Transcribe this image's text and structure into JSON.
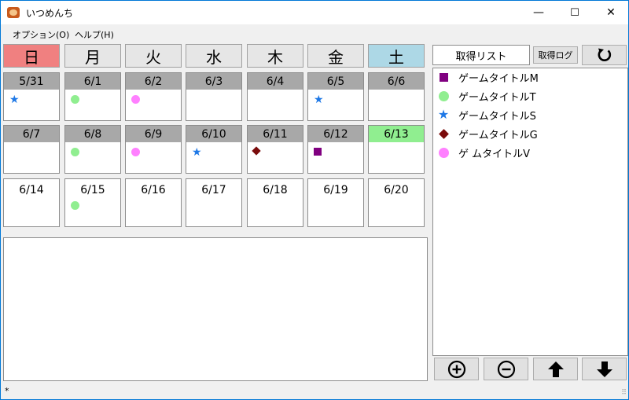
{
  "window": {
    "title": "いつめんち",
    "minimize": "—",
    "maximize": "☐",
    "close": "✕"
  },
  "menu": {
    "options": "オプション(O)",
    "help": "ヘルプ(H)"
  },
  "weekdays": [
    "日",
    "月",
    "火",
    "水",
    "木",
    "金",
    "土"
  ],
  "colors": {
    "sunday": "#f08080",
    "saturday": "#add8e6",
    "today": "#90ee90",
    "M": "#800080",
    "T": "#90ee90",
    "S": "#1e78e6",
    "G": "#7a0b0b",
    "V": "#ff80ff"
  },
  "weeks": [
    [
      {
        "date": "5/31",
        "marks": [
          "S"
        ]
      },
      {
        "date": "6/1",
        "marks": [
          "T"
        ]
      },
      {
        "date": "6/2",
        "marks": [
          "V"
        ]
      },
      {
        "date": "6/3",
        "marks": []
      },
      {
        "date": "6/4",
        "marks": []
      },
      {
        "date": "6/5",
        "marks": [
          "S"
        ]
      },
      {
        "date": "6/6",
        "marks": []
      }
    ],
    [
      {
        "date": "6/7",
        "marks": []
      },
      {
        "date": "6/8",
        "marks": [
          "T"
        ]
      },
      {
        "date": "6/9",
        "marks": [
          "V"
        ]
      },
      {
        "date": "6/10",
        "marks": [
          "S"
        ]
      },
      {
        "date": "6/11",
        "marks": [
          "G"
        ]
      },
      {
        "date": "6/12",
        "marks": [
          "M"
        ]
      },
      {
        "date": "6/13",
        "marks": [],
        "today": true
      }
    ],
    [
      {
        "date": "6/14",
        "marks": []
      },
      {
        "date": "6/15",
        "marks": [
          "T"
        ]
      },
      {
        "date": "6/16",
        "marks": []
      },
      {
        "date": "6/17",
        "marks": []
      },
      {
        "date": "6/18",
        "marks": []
      },
      {
        "date": "6/19",
        "marks": []
      },
      {
        "date": "6/20",
        "marks": []
      }
    ]
  ],
  "memo": {
    "value": ""
  },
  "panel": {
    "tab_list": "取得リスト",
    "tab_log": "取得ログ",
    "refresh_icon": "refresh-icon"
  },
  "games": [
    {
      "label": "ゲームタイトルM",
      "symbol": "M",
      "icon": "purple-square-icon"
    },
    {
      "label": "ゲームタイトルT",
      "symbol": "T",
      "icon": "green-circle-icon"
    },
    {
      "label": "ゲームタイトルS",
      "symbol": "S",
      "icon": "blue-star-icon"
    },
    {
      "label": "ゲームタイトルG",
      "symbol": "G",
      "icon": "red-diamond-icon"
    },
    {
      "label": "ゲ ムタイトルV",
      "symbol": "V",
      "icon": "pink-circle-icon"
    }
  ],
  "controls": [
    "add-icon",
    "remove-icon",
    "up-arrow-icon",
    "down-arrow-icon"
  ],
  "status": {
    "text": "*"
  }
}
